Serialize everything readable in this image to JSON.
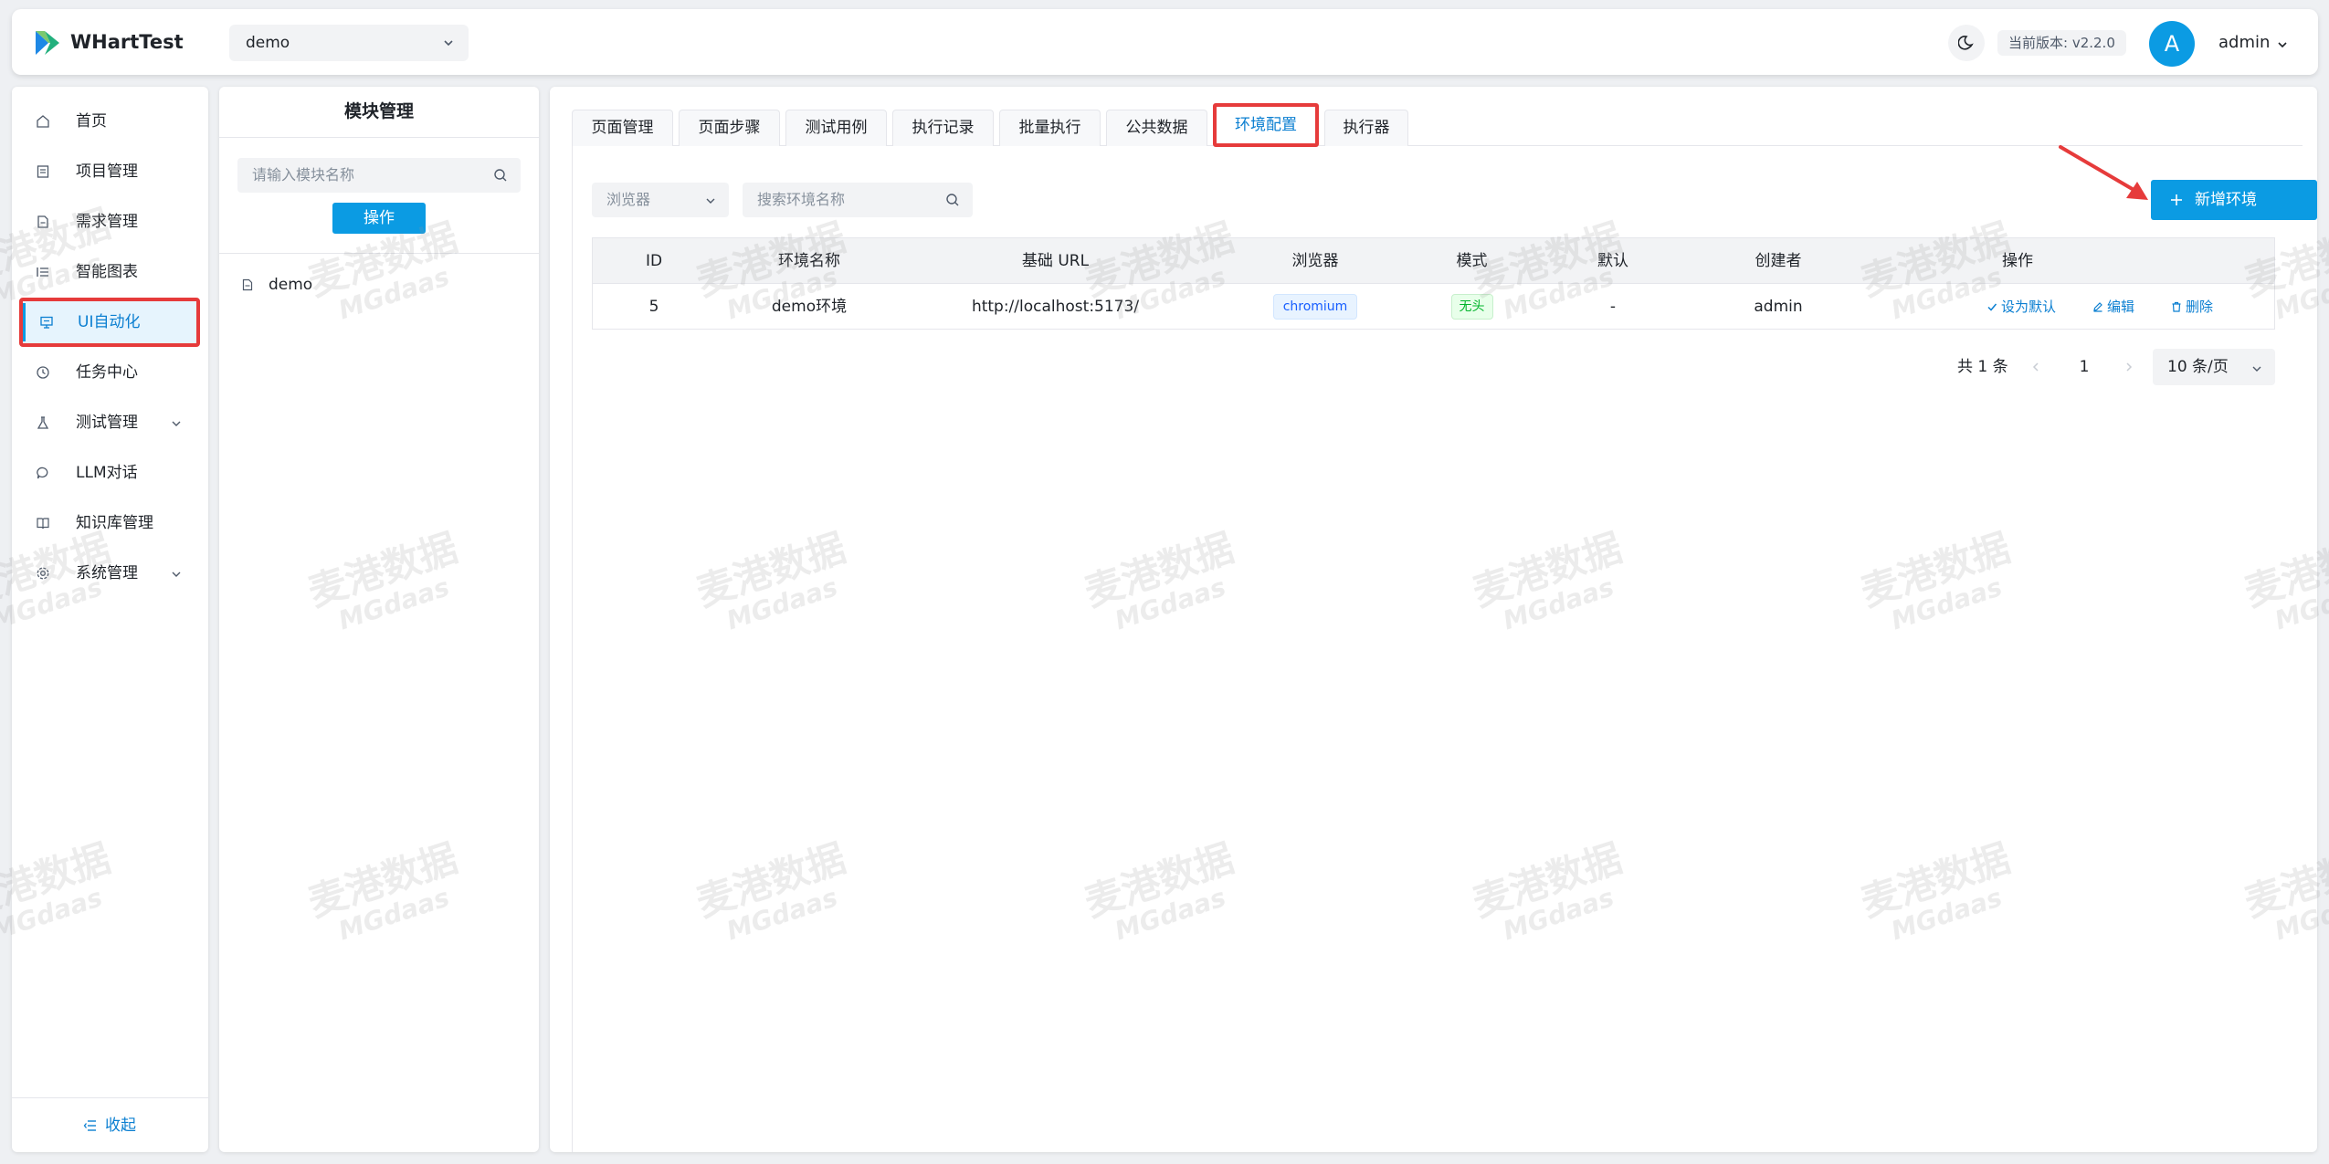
{
  "header": {
    "app_title": "WHartTest",
    "project_select": "demo",
    "version": "当前版本: v2.2.0",
    "avatar_letter": "A",
    "user_name": "admin"
  },
  "sidebar": {
    "items": [
      {
        "label": "首页",
        "icon": "home-icon"
      },
      {
        "label": "项目管理",
        "icon": "project-icon"
      },
      {
        "label": "需求管理",
        "icon": "document-icon"
      },
      {
        "label": "智能图表",
        "icon": "list-icon"
      },
      {
        "label": "UI自动化",
        "icon": "monitor-icon"
      },
      {
        "label": "任务中心",
        "icon": "clock-icon"
      },
      {
        "label": "测试管理",
        "icon": "flask-icon"
      },
      {
        "label": "LLM对话",
        "icon": "chat-icon"
      },
      {
        "label": "知识库管理",
        "icon": "book-icon"
      },
      {
        "label": "系统管理",
        "icon": "gear-icon"
      }
    ],
    "collapse_label": "收起"
  },
  "module_panel": {
    "title": "模块管理",
    "search_placeholder": "请输入模块名称",
    "operate_label": "操作",
    "tree": [
      {
        "label": "demo"
      }
    ]
  },
  "tabs": [
    "页面管理",
    "页面步骤",
    "测试用例",
    "执行记录",
    "批量执行",
    "公共数据",
    "环境配置",
    "执行器"
  ],
  "filters": {
    "browser_placeholder": "浏览器",
    "search_placeholder": "搜索环境名称",
    "add_label": "新增环境"
  },
  "table": {
    "headers": [
      "ID",
      "环境名称",
      "基础 URL",
      "浏览器",
      "模式",
      "默认",
      "创建者",
      "操作"
    ],
    "rows": [
      {
        "id": "5",
        "name": "demo环境",
        "url": "http://localhost:5173/",
        "browser": "chromium",
        "mode": "无头",
        "default": "-",
        "creator": "admin"
      }
    ],
    "actions": [
      "设为默认",
      "编辑",
      "删除"
    ]
  },
  "pagination": {
    "total": "共 1 条",
    "page": "1",
    "page_size": "10 条/页"
  },
  "watermark": {
    "line1": "麦港数据",
    "line2": "MGdaas"
  },
  "colors": {
    "primary": "#0b9be3",
    "annotation": "#e63b3b",
    "success": "#00b42a"
  }
}
